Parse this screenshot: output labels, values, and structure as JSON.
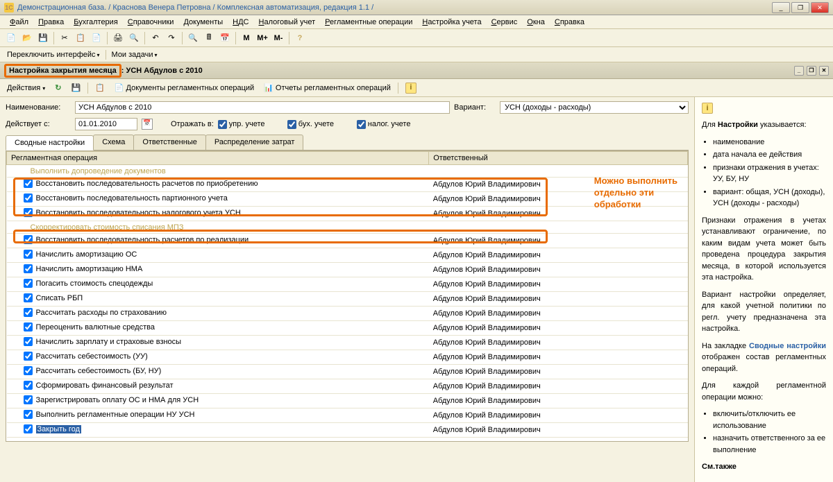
{
  "window": {
    "title": "Демонстрационная база. / Краснова Венера Петровна / Комплексная автоматизация, редакция 1.1 /"
  },
  "menubar": [
    {
      "label": "Файл",
      "u": 0
    },
    {
      "label": "Правка",
      "u": 0
    },
    {
      "label": "Бухгалтерия",
      "u": 0
    },
    {
      "label": "Справочники",
      "u": 0
    },
    {
      "label": "Документы",
      "u": 0
    },
    {
      "label": "НДС",
      "u": 0
    },
    {
      "label": "Налоговый учет",
      "u": 0
    },
    {
      "label": "Регламентные операции",
      "u": 0
    },
    {
      "label": "Настройка учета",
      "u": 0
    },
    {
      "label": "Сервис",
      "u": 0
    },
    {
      "label": "Окна",
      "u": 0
    },
    {
      "label": "Справка",
      "u": 0
    }
  ],
  "toolbar_m": [
    "M",
    "M+",
    "M-"
  ],
  "toolbar2": {
    "switch_ui": "Переключить интерфейс",
    "my_tasks": "Мои задачи"
  },
  "page": {
    "title_highlight": "Настройка закрытия месяца",
    "title_rest": ": УСН Абдулов с 2010"
  },
  "actions": {
    "menu": "Действия",
    "docs": "Документы регламентных операций",
    "reports": "Отчеты регламентных операций"
  },
  "form": {
    "name_label": "Наименование:",
    "name_value": "УСН Абдулов с 2010",
    "variant_label": "Вариант:",
    "variant_value": "УСН (доходы - расходы)",
    "date_label": "Действует с:",
    "date_value": "01.01.2010",
    "reflect_label": "Отражать в:",
    "chk_upr": "упр. учете",
    "chk_buh": "бух. учете",
    "chk_nalog": "налог. учете"
  },
  "tabs": [
    {
      "label": "Сводные настройки",
      "active": true
    },
    {
      "label": "Схема"
    },
    {
      "label": "Ответственные"
    },
    {
      "label": "Распределение затрат"
    }
  ],
  "table": {
    "col1": "Регламентная операция",
    "col2": "Ответственный",
    "rows": [
      {
        "indent": true,
        "text": "Выполнить допроведение документов"
      },
      {
        "op": true,
        "chk": true,
        "text": "Восстановить последовательность расчетов по приобретению",
        "resp": "Абдулов Юрий Владимирович",
        "hl": 1
      },
      {
        "op": true,
        "chk": true,
        "text": "Восстановить последовательность партионного учета",
        "resp": "Абдулов Юрий Владимирович",
        "hl": 1
      },
      {
        "op": true,
        "chk": true,
        "text": "Восстановить последовательность налогового учета УСН",
        "resp": "Абдулов Юрий Владимирович",
        "hl": 1
      },
      {
        "indent": true,
        "text": "Скорректировать стоимость списания МПЗ"
      },
      {
        "op": true,
        "chk": true,
        "text": "Восстановить последовательность расчетов по реализации",
        "resp": "Абдулов Юрий Владимирович",
        "hl": 2
      },
      {
        "op": true,
        "chk": true,
        "text": "Начислить амортизацию ОС",
        "resp": "Абдулов Юрий Владимирович"
      },
      {
        "op": true,
        "chk": true,
        "text": "Начислить амортизацию НМА",
        "resp": "Абдулов Юрий Владимирович"
      },
      {
        "op": true,
        "chk": true,
        "text": "Погасить стоимость спецодежды",
        "resp": "Абдулов Юрий Владимирович"
      },
      {
        "op": true,
        "chk": true,
        "text": "Списать РБП",
        "resp": "Абдулов Юрий Владимирович"
      },
      {
        "op": true,
        "chk": true,
        "text": "Рассчитать расходы по страхованию",
        "resp": "Абдулов Юрий Владимирович"
      },
      {
        "op": true,
        "chk": true,
        "text": "Переоценить валютные средства",
        "resp": "Абдулов Юрий Владимирович"
      },
      {
        "op": true,
        "chk": true,
        "text": "Начислить зарплату и страховые взносы",
        "resp": "Абдулов Юрий Владимирович"
      },
      {
        "op": true,
        "chk": true,
        "text": "Рассчитать себестоимость (УУ)",
        "resp": "Абдулов Юрий Владимирович"
      },
      {
        "op": true,
        "chk": true,
        "text": "Рассчитать себестоимость (БУ, НУ)",
        "resp": "Абдулов Юрий Владимирович"
      },
      {
        "op": true,
        "chk": true,
        "text": "Сформировать финансовый результат",
        "resp": "Абдулов Юрий Владимирович"
      },
      {
        "op": true,
        "chk": true,
        "text": "Зарегистрировать оплату ОС и НМА для УСН",
        "resp": "Абдулов Юрий Владимирович"
      },
      {
        "op": true,
        "chk": true,
        "text": "Выполнить регламентные операции НУ УСН",
        "resp": "Абдулов Юрий Владимирович"
      },
      {
        "op": true,
        "chk": true,
        "text": "Закрыть год",
        "resp": "Абдулов Юрий Владимирович",
        "sel": true
      }
    ]
  },
  "annotation": {
    "line1": "Можно выполнить",
    "line2": "отдельно эти",
    "line3": "обработки"
  },
  "help": {
    "intro_pre": "Для ",
    "intro_bold": "Настройки",
    "intro_post": " указывается:",
    "bullets1": [
      "наименование",
      "дата начала ее действия",
      "признаки отражения в учетах: УУ, БУ, НУ",
      "вариант: общая, УСН (доходы), УСН (доходы - расходы)"
    ],
    "p1": "Признаки отражения в учетах устанавливают ограничение, по каким видам учета может быть проведена процедура закрытия месяца, в которой используется эта настройка.",
    "p2": "Вариант настройки определяет, для какой учетной политики по регл. учету предназначена эта настройка.",
    "p3_pre": "На закладке ",
    "p3_bold": "Сводные настройки",
    "p3_post": " отображен состав регламентных операций.",
    "p4": "Для каждой регламентной операции можно:",
    "bullets2": [
      "включить/отключить ее использование",
      "назначить ответственного за ее выполнение"
    ],
    "seealso": "См.также"
  }
}
